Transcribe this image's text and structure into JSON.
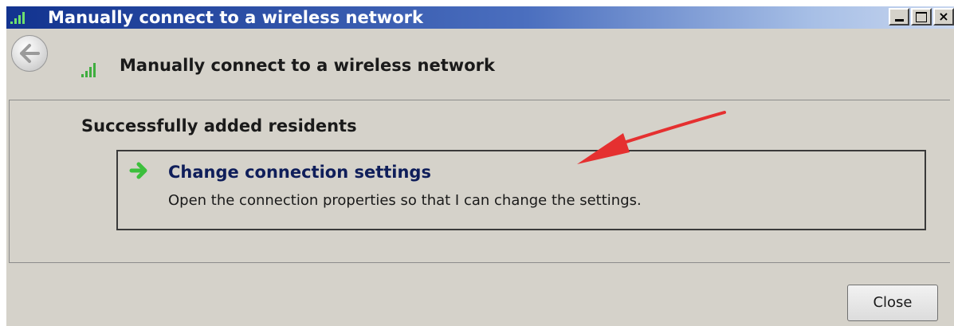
{
  "window": {
    "title": "Manually connect to a wireless network",
    "caption_close": "×"
  },
  "nav": {
    "title": "Manually connect to a wireless network"
  },
  "content": {
    "heading": "Successfully added residents",
    "option": {
      "title": "Change connection settings",
      "description": "Open the connection properties so that I can change the settings."
    }
  },
  "footer": {
    "close_label": "Close"
  },
  "icons": {
    "title_icon": "wireless-signal-icon",
    "back": "back-arrow-icon",
    "nav_icon": "wireless-signal-icon",
    "option_icon": "green-arrow-icon",
    "annotation": "red-arrow-annotation"
  },
  "colors": {
    "titlebar_start": "#12338f",
    "window_bg": "#d5d2ca",
    "option_arrow": "#3cbf3c",
    "annotation_arrow": "#e53030"
  }
}
